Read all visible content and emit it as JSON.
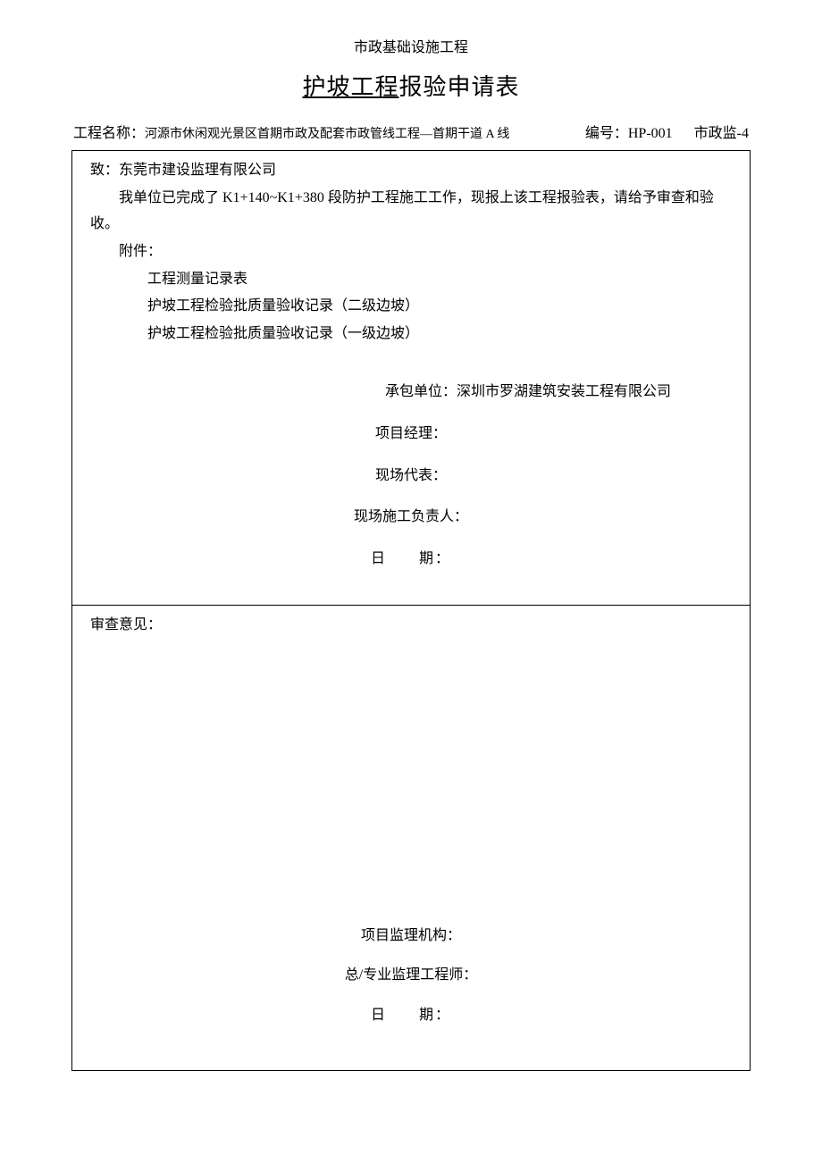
{
  "preTitle": "市政基础设施工程",
  "title": {
    "underlined": "护坡工程",
    "rest": "报验申请表"
  },
  "header": {
    "projectLabel": "工程名称：",
    "projectName": "河源市休闲观光景区首期市政及配套市政管线工程—首期干道 A 线",
    "codeLabel": "编号：",
    "code": "HP-001",
    "docType": "市政监-4"
  },
  "upper": {
    "toLabel": "致：",
    "toName": "东莞市建设监理有限公司",
    "bodyText": "我单位已完成了 K1+140~K1+380 段防护工程施工工作，现报上该工程报验表，请给予审查和验收。",
    "attachLabel": "附件：",
    "attachments": [
      "工程测量记录表",
      "护坡工程检验批质量验收记录（二级边坡）",
      "护坡工程检验批质量验收记录（一级边坡）"
    ],
    "contractorLabel": "承包单位：",
    "contractorName": "深圳市罗湖建筑安装工程有限公司",
    "pmLabel": "项目经理：",
    "siteRepLabel": "现场代表：",
    "siteMgrLabel": "现场施工负责人：",
    "dateLabel": "日　　期："
  },
  "lower": {
    "opinionLabel": "审查意见：",
    "supervisionOrgLabel": "项目监理机构：",
    "engineerLabel": "总/专业监理工程师：",
    "dateLabel": "日　　期："
  }
}
